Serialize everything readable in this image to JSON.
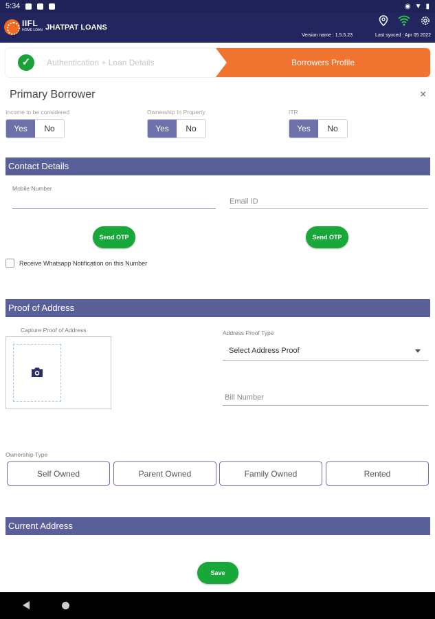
{
  "status_bar": {
    "time": "5:34"
  },
  "app_bar": {
    "brand": "IIFL",
    "brand_sub": "HOME LOAN",
    "title": "JHATPAT LOANS",
    "version": "Version name : 1.5.5.23",
    "last_synced": "Last synced : Apr 05 2022"
  },
  "stepper": {
    "step1": "Authentication + Loan Details",
    "step2": "Borrowers Profile"
  },
  "page_title": "Primary Borrower",
  "close_label": "×",
  "toggles": {
    "income": {
      "label": "Income to be considered",
      "yes": "Yes",
      "no": "No",
      "selected": "Yes"
    },
    "ownership": {
      "label": "Ownership In Property",
      "yes": "Yes",
      "no": "No",
      "selected": "Yes"
    },
    "itr": {
      "label": "ITR",
      "yes": "Yes",
      "no": "No",
      "selected": "Yes"
    }
  },
  "contact": {
    "section_title": "Contact Details",
    "mobile_label": "Mobile Number",
    "email_placeholder": "Email ID",
    "send_otp": "Send OTP",
    "whatsapp_label": "Receive Whatsapp Notification on this Number"
  },
  "proof": {
    "section_title": "Proof of Address",
    "capture_label": "Capture Proof of Address",
    "type_label": "Address Proof Type",
    "select_value": "Select Address Proof",
    "bill_placeholder": "Bill Number"
  },
  "ownership_type": {
    "label": "Ownership Type",
    "options": [
      "Self Owned",
      "Parent Owned",
      "Family Owned",
      "Rented"
    ]
  },
  "current_address": {
    "section_title": "Current Address"
  },
  "save_label": "Save",
  "colors": {
    "app_bar": "#23265e",
    "accent_orange": "#f07430",
    "section_header": "#595f99",
    "toggle_selected": "#6e70a9",
    "button_green": "#18a83a"
  }
}
